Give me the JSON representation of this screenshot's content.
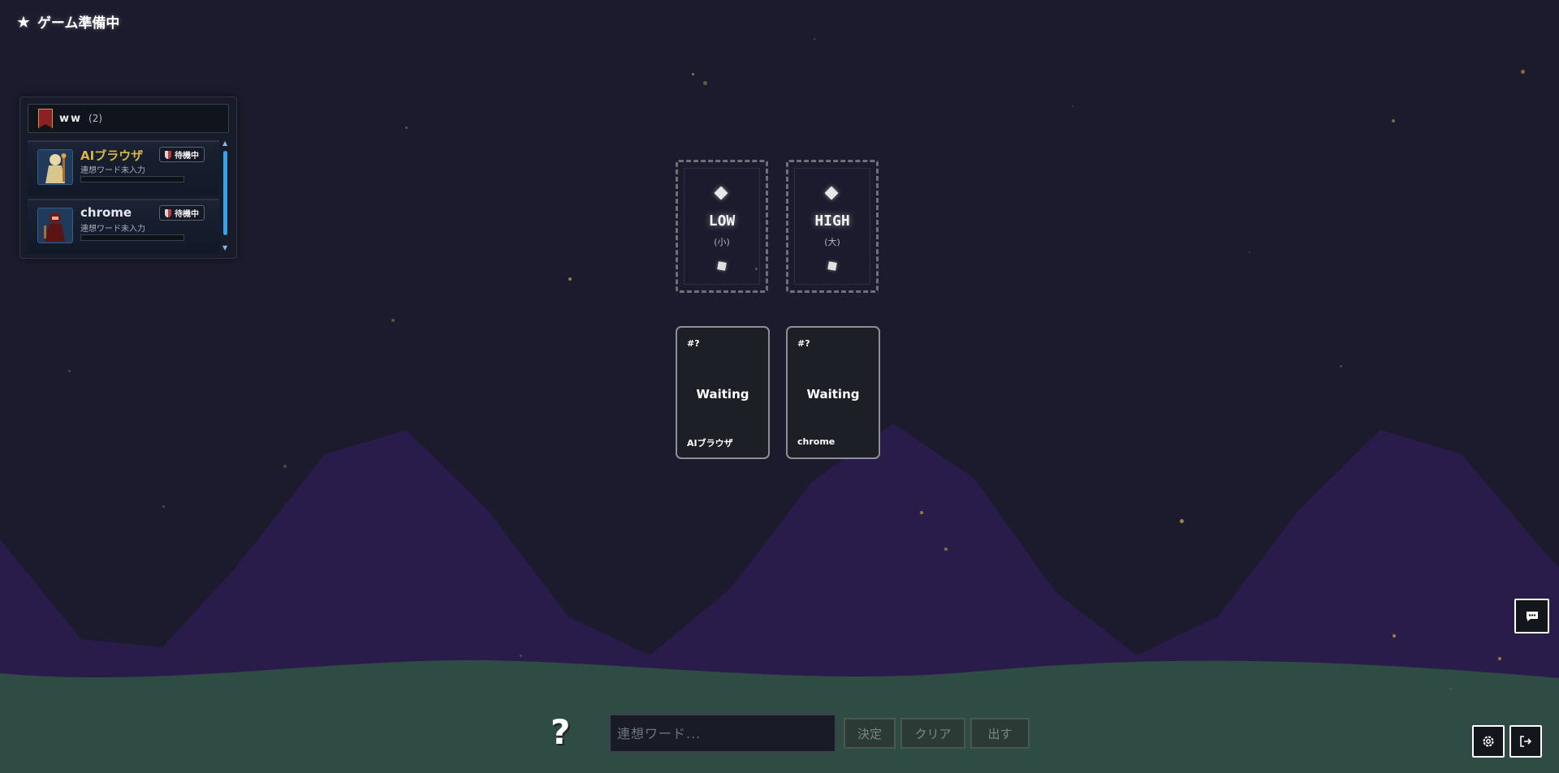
{
  "status": {
    "icon": "star-icon",
    "text": "ゲーム準備中"
  },
  "room": {
    "name": "ww",
    "count": "(2)"
  },
  "players": [
    {
      "name": "AIブラウザ",
      "sub": "連想ワード未入力",
      "badge": "待機中"
    },
    {
      "name": "chrome",
      "sub": "連想ワード未入力",
      "badge": "待機中"
    }
  ],
  "slots": {
    "low": {
      "label": "LOW",
      "sub": "(小)"
    },
    "high": {
      "label": "HIGH",
      "sub": "(大)"
    }
  },
  "cards": [
    {
      "number": "#?",
      "state": "Waiting",
      "owner": "AIブラウザ"
    },
    {
      "number": "#?",
      "state": "Waiting",
      "owner": "chrome"
    }
  ],
  "controls": {
    "hint_icon": "?",
    "placeholder": "連想ワード...",
    "decide_label": "決定",
    "clear_label": "クリア",
    "play_label": "出す"
  },
  "colors": {
    "sky": "#1b1b2d",
    "mountain": "#2a1c4a",
    "ground": "#2e4b44",
    "accent_name": "#d9b545",
    "scroll_thumb": "#3aa0e8"
  }
}
